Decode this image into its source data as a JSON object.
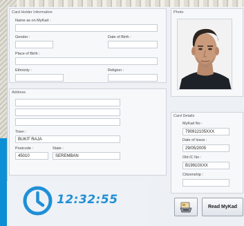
{
  "card_holder": {
    "title": "Card Holder Information",
    "name_label": "Name as on MyKad :",
    "name_value": "",
    "gender_label": "Gender :",
    "gender_value": "",
    "dob_label": "Date of Birth :",
    "dob_value": "",
    "pob_label": "Place of Birth :",
    "pob_value": "",
    "ethnicity_label": "Ethnicity :",
    "ethnicity_value": "",
    "religion_label": "Religion :",
    "religion_value": ""
  },
  "photo": {
    "title": "Photo"
  },
  "address": {
    "title": "Address",
    "line1": "",
    "line2": "",
    "line3": "",
    "town_label": "Town :",
    "town_value": "BUKIT RAJA",
    "postcode_label": "Postcode :",
    "postcode_value": "45010",
    "state_label": "State :",
    "state_value": "SEREMBAN"
  },
  "card_details": {
    "title": "Card Details",
    "mykad_no_label": "MyKad No :",
    "mykad_no_value": "790912105XXX",
    "date_of_issue_label": "Date of Issue :",
    "date_of_issue_value": "29/05/2005",
    "old_ic_label": "Old IC No :",
    "old_ic_value": "B19910XXX",
    "citizenship_label": "Citizenship :",
    "citizenship_value": ""
  },
  "clock": {
    "time": "12:32:55",
    "icon": "clock-icon",
    "color": "#1e90d6"
  },
  "actions": {
    "read_mykad_label": "Read MyKad",
    "card_reader_icon": "card-reader-icon"
  },
  "colors": {
    "background": "#0d8fd6",
    "accent": "#1e90d6"
  }
}
